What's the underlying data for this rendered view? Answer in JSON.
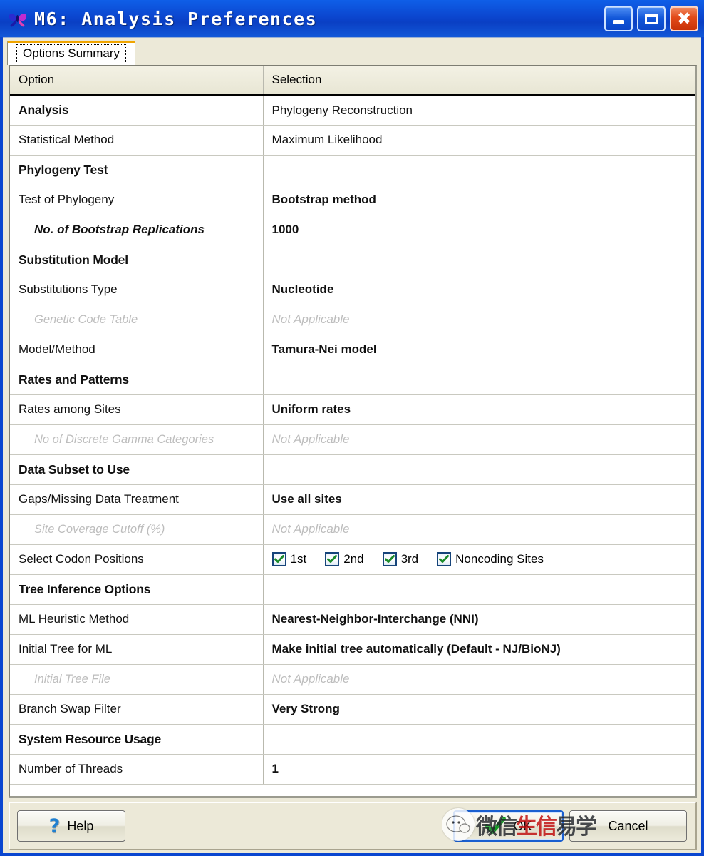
{
  "window": {
    "title": "M6: Analysis Preferences",
    "app_icon": "mega-butterfly-icon",
    "minimize_label": "–",
    "maximize_label": "❐",
    "close_label": "✕"
  },
  "tabs": [
    {
      "label": "Options Summary",
      "active": true
    }
  ],
  "table": {
    "headers": [
      "Option",
      "Selection"
    ],
    "rows": [
      {
        "option": "Analysis",
        "selection": "Phylogeny Reconstruction",
        "style": "section",
        "sel_style": "plain"
      },
      {
        "option": "Statistical Method",
        "selection": "Maximum Likelihood",
        "style": "normal",
        "sel_style": "plain"
      },
      {
        "option": "Phylogeny Test",
        "selection": "",
        "style": "section",
        "sel_style": "grey"
      },
      {
        "option": "Test of Phylogeny",
        "selection": "Bootstrap method",
        "style": "normal",
        "sel_style": "yellow"
      },
      {
        "option": "No. of Bootstrap Replications",
        "selection": "1000",
        "style": "sub",
        "sel_style": "yellow"
      },
      {
        "option": "Substitution Model",
        "selection": "",
        "style": "section",
        "sel_style": "grey"
      },
      {
        "option": "Substitutions Type",
        "selection": "Nucleotide",
        "style": "normal",
        "sel_style": "yellow"
      },
      {
        "option": "Genetic Code Table",
        "selection": "Not Applicable",
        "style": "disabled",
        "sel_style": "plain"
      },
      {
        "option": "Model/Method",
        "selection": "Tamura-Nei model",
        "style": "normal",
        "sel_style": "yellow"
      },
      {
        "option": "Rates and Patterns",
        "selection": "",
        "style": "section",
        "sel_style": "grey"
      },
      {
        "option": "Rates among Sites",
        "selection": "Uniform rates",
        "style": "normal",
        "sel_style": "yellow"
      },
      {
        "option": "No of Discrete Gamma Categories",
        "selection": "Not Applicable",
        "style": "disabled",
        "sel_style": "plain"
      },
      {
        "option": "Data Subset to Use",
        "selection": "",
        "style": "section",
        "sel_style": "grey"
      },
      {
        "option": "Gaps/Missing Data Treatment",
        "selection": "Use all sites",
        "style": "normal",
        "sel_style": "yellow"
      },
      {
        "option": "Site Coverage Cutoff (%)",
        "selection": "Not Applicable",
        "style": "disabled",
        "sel_style": "plain"
      },
      {
        "option": "Select Codon Positions",
        "selection": "",
        "style": "normal",
        "sel_style": "checkboxes"
      },
      {
        "option": "Tree Inference Options",
        "selection": "",
        "style": "section",
        "sel_style": "grey"
      },
      {
        "option": "ML Heuristic Method",
        "selection": "Nearest-Neighbor-Interchange (NNI)",
        "style": "normal",
        "sel_style": "yellow"
      },
      {
        "option": "Initial Tree for ML",
        "selection": "Make initial tree automatically (Default - NJ/BioNJ)",
        "style": "normal",
        "sel_style": "yellow"
      },
      {
        "option": "Initial Tree File",
        "selection": "Not Applicable",
        "style": "disabled",
        "sel_style": "plain"
      },
      {
        "option": "Branch Swap Filter",
        "selection": "Very Strong",
        "style": "normal",
        "sel_style": "yellow"
      },
      {
        "option": "System Resource Usage",
        "selection": "",
        "style": "section",
        "sel_style": "grey"
      },
      {
        "option": "Number of Threads",
        "selection": "1",
        "style": "normal",
        "sel_style": "yellow"
      }
    ],
    "codon_positions": [
      {
        "label": "1st",
        "checked": true
      },
      {
        "label": "2nd",
        "checked": true
      },
      {
        "label": "3rd",
        "checked": true
      },
      {
        "label": "Noncoding Sites",
        "checked": true
      }
    ]
  },
  "buttons": {
    "help": "Help",
    "ok": "OK",
    "cancel": "Cancel"
  },
  "watermark": {
    "text_left": "微信",
    "text_mid": "生信",
    "text_right": "易学"
  },
  "colors": {
    "title_blue": "#0a46cf",
    "highlight_yellow": "#ffff00",
    "section_grey": "#bfbfbf",
    "disabled_grey": "#bdbdbd",
    "panel": "#ece9d8",
    "tab_top_accent": "#f0a500"
  }
}
